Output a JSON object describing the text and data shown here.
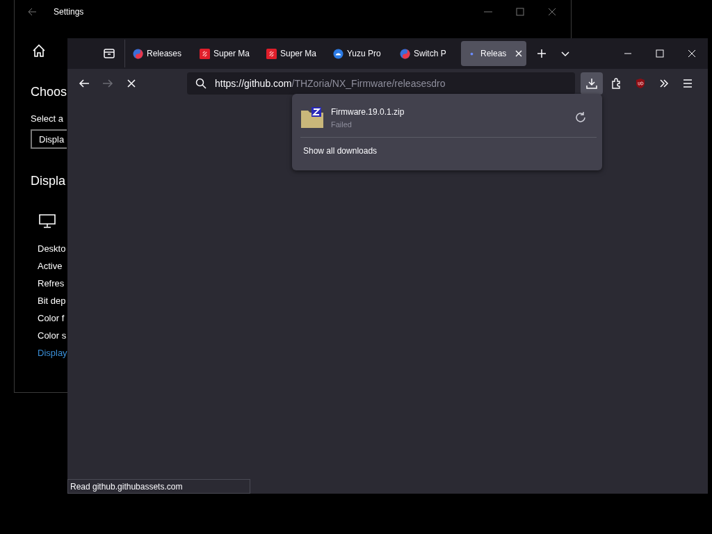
{
  "settings_window": {
    "title": "Settings",
    "heading": "Choos",
    "select_label": "Select a",
    "select_value": "Displa",
    "section_heading": "Displa",
    "items": [
      {
        "label": "Deskto",
        "kind": "text"
      },
      {
        "label": "Active",
        "kind": "text"
      },
      {
        "label": "Refres",
        "kind": "text"
      },
      {
        "label": "Bit dep",
        "kind": "text"
      },
      {
        "label": "Color f",
        "kind": "text"
      },
      {
        "label": "Color s",
        "kind": "text"
      },
      {
        "label": "Display",
        "kind": "link"
      }
    ]
  },
  "browser": {
    "tabs": [
      {
        "label": "Releases",
        "kind": "swirl",
        "selected": false
      },
      {
        "label": "Super Ma",
        "kind": "red",
        "selected": false
      },
      {
        "label": "Super Ma",
        "kind": "red",
        "selected": false
      },
      {
        "label": "Yuzu Pro",
        "kind": "blue",
        "selected": false
      },
      {
        "label": "Switch P",
        "kind": "swirl",
        "selected": false
      },
      {
        "label": "Releas",
        "kind": "loading",
        "selected": true
      }
    ],
    "forward_disabled": true,
    "url_host": "https://github.com",
    "url_path": "/THZoria/NX_Firmware/releasesdro",
    "status_text": "Read github.githubassets.com"
  },
  "downloads_panel": {
    "items": [
      {
        "file": "Firmware.19.0.1.zip",
        "status": "Failed"
      }
    ],
    "footer": "Show all downloads"
  }
}
